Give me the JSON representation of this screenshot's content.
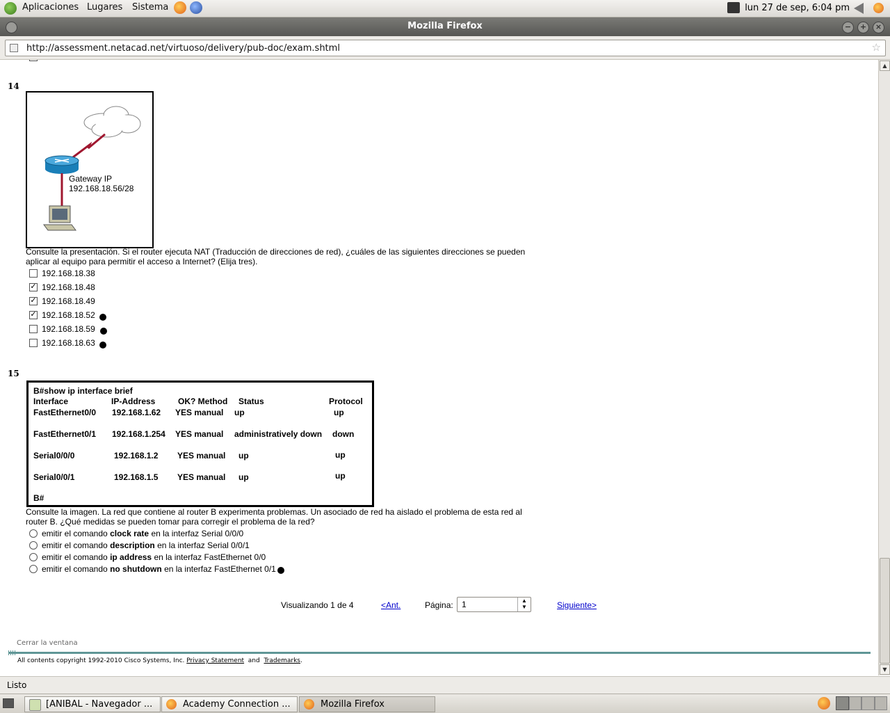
{
  "panel": {
    "menus": [
      "Aplicaciones",
      "Lugares",
      "Sistema"
    ],
    "clock": "lun 27 de sep,  6:04 pm"
  },
  "window": {
    "title": "Mozilla Firefox",
    "url": "http://assessment.netacad.net/virtuoso/delivery/pub-doc/exam.shtml"
  },
  "q14": {
    "number": "14",
    "diagram": {
      "label_line1": "Gateway IP",
      "label_line2": "192.168.18.56/28"
    },
    "text": "Consulte la presentación. Si el router ejecuta NAT (Traducción de direcciones de red), ¿cuáles de las siguientes direcciones se pueden aplicar al equipo para permitir el acceso a Internet? (Elija tres).",
    "options": [
      {
        "label": "192.168.18.38",
        "checked": false,
        "marked": false
      },
      {
        "label": "192.168.18.48",
        "checked": true,
        "marked": false
      },
      {
        "label": "192.168.18.49",
        "checked": true,
        "marked": false
      },
      {
        "label": "192.168.18.52",
        "checked": true,
        "marked": true
      },
      {
        "label": "192.168.18.59",
        "checked": false,
        "marked": true
      },
      {
        "label": "192.168.18.63",
        "checked": false,
        "marked": true
      }
    ]
  },
  "q15": {
    "number": "15",
    "cli": {
      "command": "B#show ip interface brief",
      "headers": [
        "Interface",
        "IP-Address",
        "OK? Method",
        "Status",
        "Protocol"
      ],
      "rows": [
        [
          "FastEthernet0/0",
          "192.168.1.62",
          "YES manual",
          "up",
          "up"
        ],
        [
          "FastEthernet0/1",
          "192.168.1.254",
          "YES manual",
          "administratively down",
          "down"
        ],
        [
          "Serial0/0/0",
          "192.168.1.2",
          "YES manual",
          "up",
          "up"
        ],
        [
          "Serial0/0/1",
          "192.168.1.5",
          "YES manual",
          "up",
          "up"
        ]
      ],
      "prompt": "B#"
    },
    "text": "Consulte la imagen. La red que contiene al router B experimenta problemas. Un asociado de red ha aislado el problema de esta red al router B. ¿Qué medidas se pueden tomar para corregir el problema de la red?",
    "options": [
      {
        "pre": "emitir el comando",
        "bold": "clock rate",
        "post": "en la interfaz Serial 0/0/0",
        "marked": false
      },
      {
        "pre": "emitir el comando",
        "bold": "description",
        "post": "en la interfaz Serial 0/0/1",
        "marked": false
      },
      {
        "pre": "emitir el comando",
        "bold": "ip address",
        "post": "en la interfaz FastEthernet 0/0",
        "marked": false
      },
      {
        "pre": "emitir el comando",
        "bold": "no shutdown",
        "post": "en la interfaz FastEthernet 0/1",
        "marked": true
      }
    ]
  },
  "pager": {
    "viewing": "Visualizando 1 de 4",
    "prev": "<Ant.",
    "page_label": "Página:",
    "page_value": "1",
    "next": "Siguiente>"
  },
  "footer": {
    "close": "Cerrar la ventana",
    "copyright": "All contents copyright 1992-2010 Cisco Systems, Inc.",
    "privacy": "Privacy Statement",
    "and": "and",
    "trademarks": "Trademarks",
    "period": "."
  },
  "status": "Listo",
  "taskbar": [
    {
      "label": "[ANIBAL - Navegador ...",
      "active": false
    },
    {
      "label": "Academy Connection ...",
      "active": false
    },
    {
      "label": "Mozilla Firefox",
      "active": true
    }
  ],
  "colors": {
    "footer_rule": "#5f9696",
    "link": "#0000cc",
    "link_cable": "#a01830"
  }
}
